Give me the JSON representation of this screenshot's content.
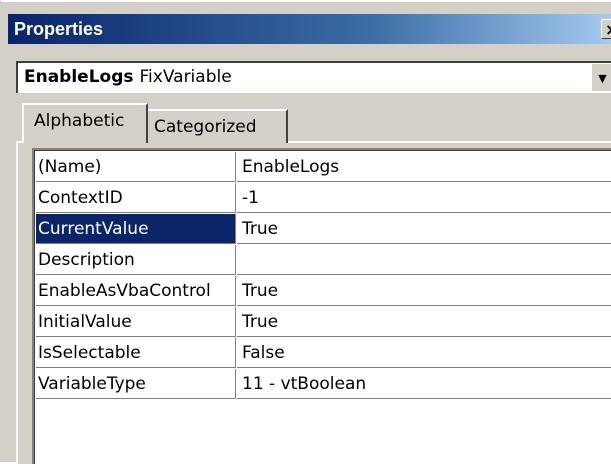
{
  "window": {
    "title": "Properties",
    "close_glyph": "×"
  },
  "object_combo": {
    "name": "EnableLogs",
    "type": "FixVariable",
    "arrow_glyph": "▼"
  },
  "tabs": [
    {
      "label": "Alphabetic",
      "active": true
    },
    {
      "label": "Categorized",
      "active": false
    }
  ],
  "properties": [
    {
      "name": "(Name)",
      "value": "EnableLogs"
    },
    {
      "name": "ContextID",
      "value": "-1"
    },
    {
      "name": "CurrentValue",
      "value": "True",
      "selected": true
    },
    {
      "name": "Description",
      "value": ""
    },
    {
      "name": "EnableAsVbaControl",
      "value": "True"
    },
    {
      "name": "InitialValue",
      "value": "True"
    },
    {
      "name": "IsSelectable",
      "value": "False"
    },
    {
      "name": "VariableType",
      "value": "11 - vtBoolean"
    }
  ],
  "colors": {
    "title_bar": "#0a246a",
    "selection": "#0a246a",
    "face": "#d4d0c8"
  }
}
